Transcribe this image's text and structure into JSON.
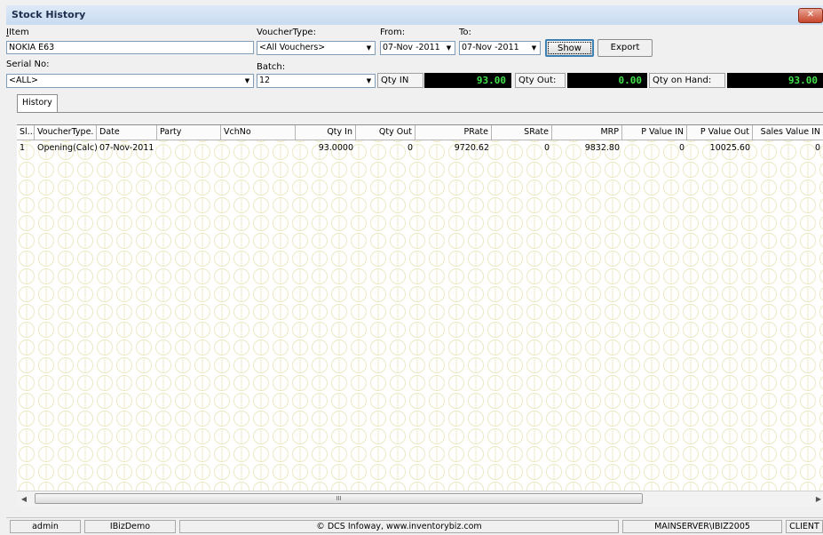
{
  "window": {
    "title": "Stock History",
    "close_icon": "close-icon"
  },
  "filters": {
    "item_label": "Item",
    "item_value": "NOKIA E63",
    "voucher_type_label": "VoucherType:",
    "voucher_type_value": "<All Vouchers>",
    "from_label": "From:",
    "from_value": "07-Nov -2011",
    "to_label": "To:",
    "to_value": "07-Nov -2011",
    "serial_label": "Serial No:",
    "serial_value": "<ALL>",
    "batch_label": "Batch:",
    "batch_value": "12"
  },
  "buttons": {
    "show": "Show",
    "export": "Export"
  },
  "summary": {
    "qty_in_label": "Qty IN",
    "qty_in_value": "93.00",
    "qty_out_label": "Qty Out:",
    "qty_out_value": "0.00",
    "qty_on_hand_label": "Qty on Hand:",
    "qty_on_hand_value": "93.00",
    "value_color": "#41e14a"
  },
  "tabs": [
    {
      "label": "History"
    }
  ],
  "table": {
    "columns": [
      "Sl...",
      "VoucherType.",
      "Date",
      "Party",
      "VchNo",
      "Qty In",
      "Qty Out",
      "PRate",
      "SRate",
      "MRP",
      "P Value IN",
      "P Value Out",
      "Sales Value IN"
    ],
    "rows": [
      [
        "1",
        "Opening(Calc)",
        "07-Nov-2011",
        "",
        "",
        "93.0000",
        "0",
        "9720.62",
        "0",
        "9832.80",
        "0",
        "10025.60",
        "0"
      ]
    ]
  },
  "scrollbar": {
    "thumb_glyph": "III"
  },
  "status": {
    "user": "admin",
    "company": "IBizDemo",
    "copyright": "© DCS Infoway, www.inventorybiz.com",
    "server": "MAINSERVER\\IBIZ2005",
    "mode": "CLIENT"
  }
}
